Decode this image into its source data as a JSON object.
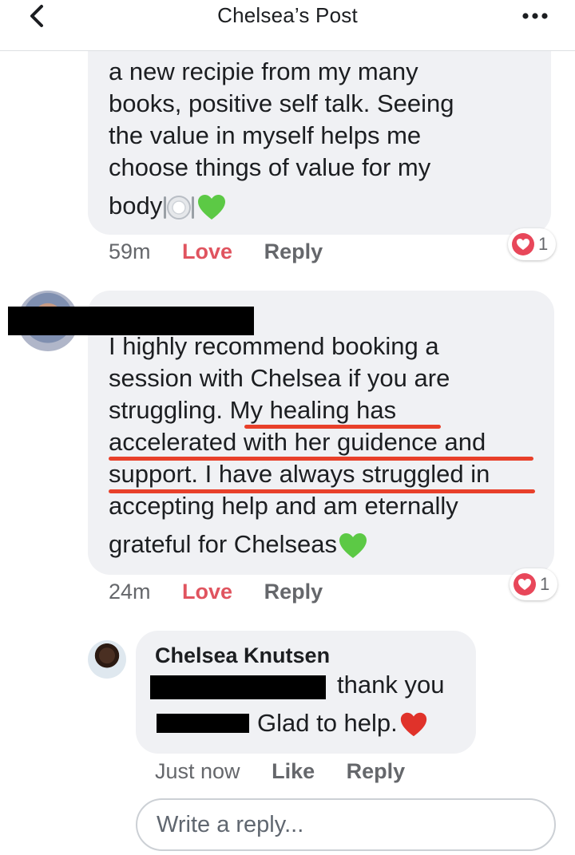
{
  "header": {
    "title": "Chelsea’s Post",
    "back_icon": "chevron-left-icon",
    "more_icon": "more-dots-icon"
  },
  "comment1": {
    "lines": [
      "a new recipie from my many",
      "books, positive self talk. Seeing",
      "the value in myself helps me",
      "choose things of value for my",
      "body"
    ],
    "emojis": [
      "plate-cutlery-icon",
      "green-heart-icon"
    ],
    "time": "59m",
    "love_label": "Love",
    "reply_label": "Reply",
    "reaction_count": "1"
  },
  "comment2": {
    "lines": [
      "I highly recommend booking a",
      "session with Chelsea if you are",
      "struggling. My healing has",
      "accelerated with her guidence and",
      "support. I have always struggled in",
      "accepting help and am eternally",
      "grateful for Chelseas"
    ],
    "line3_prefix": "struggling. ",
    "line3_highlight": "My healing has",
    "emoji": "green-heart-icon",
    "time": "24m",
    "love_label": "Love",
    "reply_label": "Reply",
    "reaction_count": "1"
  },
  "reply": {
    "author": "Chelsea Knutsen",
    "line1_suffix": "thank you",
    "line2_suffix": "Glad to help.",
    "emoji": "red-heart-icon",
    "time": "Just now",
    "like_label": "Like",
    "reply_label": "Reply"
  },
  "composer": {
    "placeholder": "Write a reply..."
  },
  "colors": {
    "bubble": "#f0f1f4",
    "love": "#e0545f",
    "underline": "#e8402a",
    "muted": "#65676b"
  }
}
